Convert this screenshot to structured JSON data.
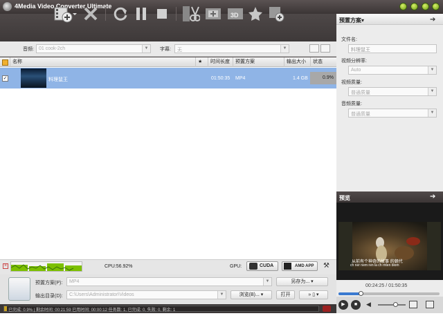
{
  "app": {
    "title": "4Media Video Converter Ultimate"
  },
  "window_buttons": [
    "minimize-icon",
    "maximize-icon",
    "help-icon",
    "close-icon"
  ],
  "filter": {
    "audio_label": "音频:",
    "audio_value": "01 cook-2ch",
    "subtitle_label": "字幕:",
    "subtitle_value": "无"
  },
  "list": {
    "headers": {
      "name": "名称",
      "star": "★",
      "duration": "时间长度",
      "profile": "预置方案",
      "size": "输出大小",
      "status": "状态"
    },
    "rows": [
      {
        "name": "料理鼠王",
        "duration": "01:50:35",
        "profile": "MP4",
        "size": "1.4 GB",
        "status": "0.9%"
      }
    ]
  },
  "statusbar": {
    "cpu": "CPU:56.92%",
    "gpu_label": "GPU:",
    "cuda": "CUDA",
    "amd": "AMD APP"
  },
  "output": {
    "profile_label": "预置方案(P):",
    "profile_value": "MP4",
    "save_as": "另存为...",
    "dir_label": "输出目录(D):",
    "dir_value": "C:\\Users\\Administrator\\Videos",
    "browse": "浏览(B)...",
    "open": "打开"
  },
  "progress": {
    "text": "已完成: 0.9% | 剩余时间: 00:21:59 已用时间: 00:00:12 任务数: 1, 已完成: 0, 失败: 0, 剩余: 1",
    "value": 0.9,
    "bold_complete": "0.9%"
  },
  "rightpanel": {
    "title": "预置方案▾",
    "filename_label": "文件名:",
    "filename_value": "料理鼠王",
    "resolution_label": "视频分辨率:",
    "resolution_value": "Auto",
    "video_quality_label": "视频质量:",
    "video_quality_value": "普通质量",
    "audio_quality_label": "音频质量:",
    "audio_quality_value": "普通质量"
  },
  "preview": {
    "title": "预览",
    "time": "00:24:25 / 01:50:35",
    "subtitle_line1": "从前有个神奇的故事 的朝代",
    "subtitle_line2": "ch ner nem ren la ch rnten blom"
  },
  "colors": {
    "accent": "#8fb4e6",
    "titlebar": "#3b3535",
    "green": "#7cc000"
  }
}
